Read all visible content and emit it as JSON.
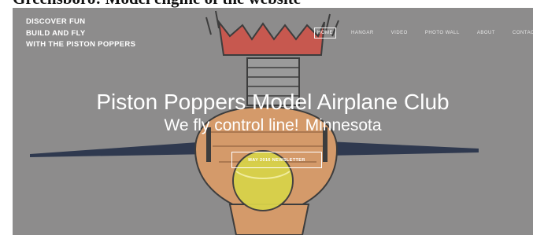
{
  "page_caption": "Greensboro: Model engine of the website",
  "tagline": {
    "line1": "DISCOVER FUN",
    "line2": "BUILD AND FLY",
    "line3": "WITH THE PISTON POPPERS"
  },
  "nav": {
    "items": [
      {
        "label": "HOME",
        "active": true
      },
      {
        "label": "HANGAR",
        "active": false
      },
      {
        "label": "VIDEO",
        "active": false
      },
      {
        "label": "PHOTO WALL",
        "active": false
      },
      {
        "label": "ABOUT",
        "active": false
      },
      {
        "label": "CONTACT",
        "active": false
      }
    ]
  },
  "hero": {
    "title": "Piston Poppers Model Airplane Club",
    "subtitle": "We fly control line!",
    "place": "Minnesota",
    "button_label": "MAY 2016 NEWSLETTER",
    "image_icon": "model-airplane-engine-illustration"
  },
  "colors": {
    "hero_background": "#8d8c8c",
    "text": "#ffffff",
    "wing": "#1f2a44",
    "fist": "#d49a6a",
    "ball": "#d8d24a",
    "crown": "#c7584f"
  }
}
